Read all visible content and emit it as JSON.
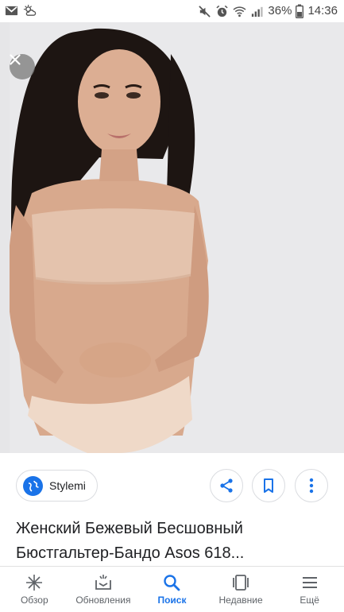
{
  "status_bar": {
    "left_icons": [
      "gmail-icon",
      "weather-icon"
    ],
    "right_icons": [
      "mute-icon",
      "alarm-icon",
      "wifi-icon",
      "signal-icon",
      "battery-icon"
    ],
    "battery": "36%",
    "time": "14:36"
  },
  "viewer": {
    "close_icon": "close-icon"
  },
  "result": {
    "source": "Stylemi",
    "title_line1": "Женский Бежевый Бесшовный",
    "title_line2": "Бюстгальтер-Бандо Asos 618..."
  },
  "actions": {
    "share_icon": "share-icon",
    "bookmark_icon": "bookmark-icon",
    "more_icon": "more-vert-icon"
  },
  "bottom_nav": {
    "items": [
      {
        "label": "Обзор",
        "icon": "discover-icon"
      },
      {
        "label": "Обновления",
        "icon": "updates-icon"
      },
      {
        "label": "Поиск",
        "icon": "search-icon",
        "active": true
      },
      {
        "label": "Недавние",
        "icon": "recent-icon"
      },
      {
        "label": "Ещё",
        "icon": "menu-icon"
      }
    ],
    "active_color": "#1a73e8",
    "inactive_color": "#5f6368"
  }
}
